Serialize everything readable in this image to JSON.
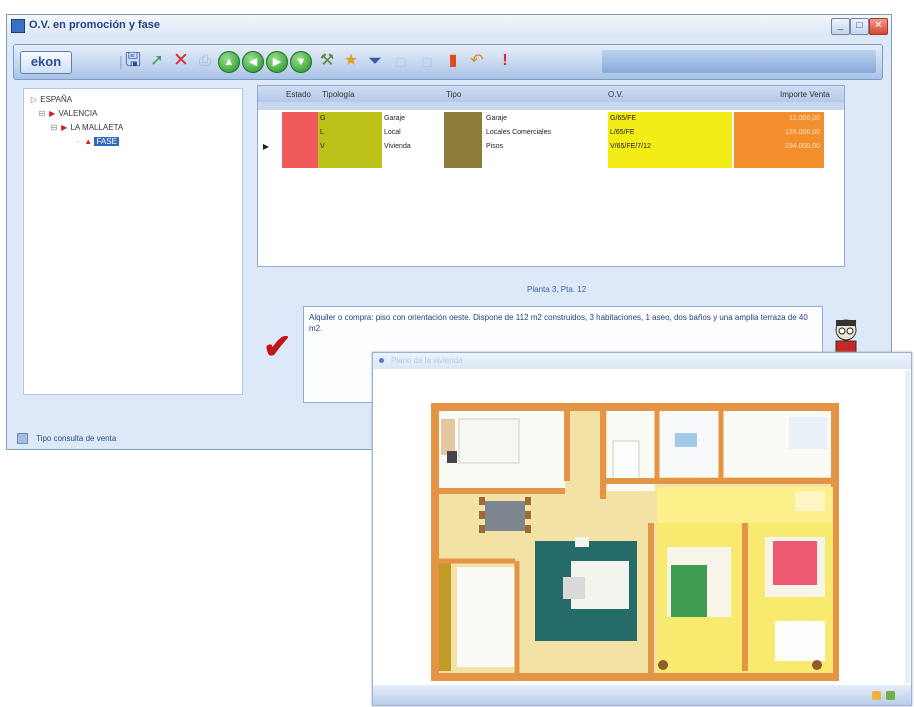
{
  "window": {
    "title": "O.V. en promoción y fase",
    "min_label": "_",
    "max_label": "□",
    "close_label": "✕"
  },
  "toolbar": {
    "logo": "ekon",
    "save_icon": "save-icon",
    "arrow_icons": [
      "▲",
      "◀",
      "▶",
      "▼"
    ]
  },
  "tree": {
    "items": [
      {
        "label": "ESPAÑA",
        "icon": "orange-arrow"
      },
      {
        "label": "VALENCIA",
        "icon": "red-square"
      },
      {
        "label": "LA MALLAETA",
        "icon": "red-square"
      },
      {
        "label": "FASE",
        "icon": "red-square",
        "selected": true
      }
    ]
  },
  "grid": {
    "headers": [
      "Estado",
      "Tipología",
      "Tipo",
      "O.V.",
      "Importe Venta"
    ],
    "rows": [
      {
        "tipologia_code": "G",
        "tipologia": "Garaje",
        "tipo_desc": "Garaje",
        "ov": "G/65/FE",
        "importe": "12.000,00"
      },
      {
        "tipologia_code": "L",
        "tipologia": "Local",
        "tipo_desc": "Locales Comerciales",
        "ov": "L/65/FE",
        "importe": "135.000,00"
      },
      {
        "tipologia_code": "V",
        "tipologia": "Vivienda",
        "tipo_desc": "Pisos",
        "ov": "V/65/FE/7/12",
        "importe": "234.000,00"
      }
    ],
    "colors": {
      "estado": "#f15a5a",
      "tipologia": "#bcc21a",
      "tipo": "#8d7d3a",
      "ov": "#f3ec17",
      "importe": "#f28e2c"
    }
  },
  "caption": "Planta 3, Pta. 12",
  "description": "Alquiler o compra: piso con orientación oeste. Dispone de 112 m2 construidos, 3 habitaciones, 1 aseo, dos baños y una amplia terraza de 40 m2.",
  "status": {
    "text": "Tipo consulta de venta"
  },
  "plan_window": {
    "title": "Plano de la vivienda"
  }
}
